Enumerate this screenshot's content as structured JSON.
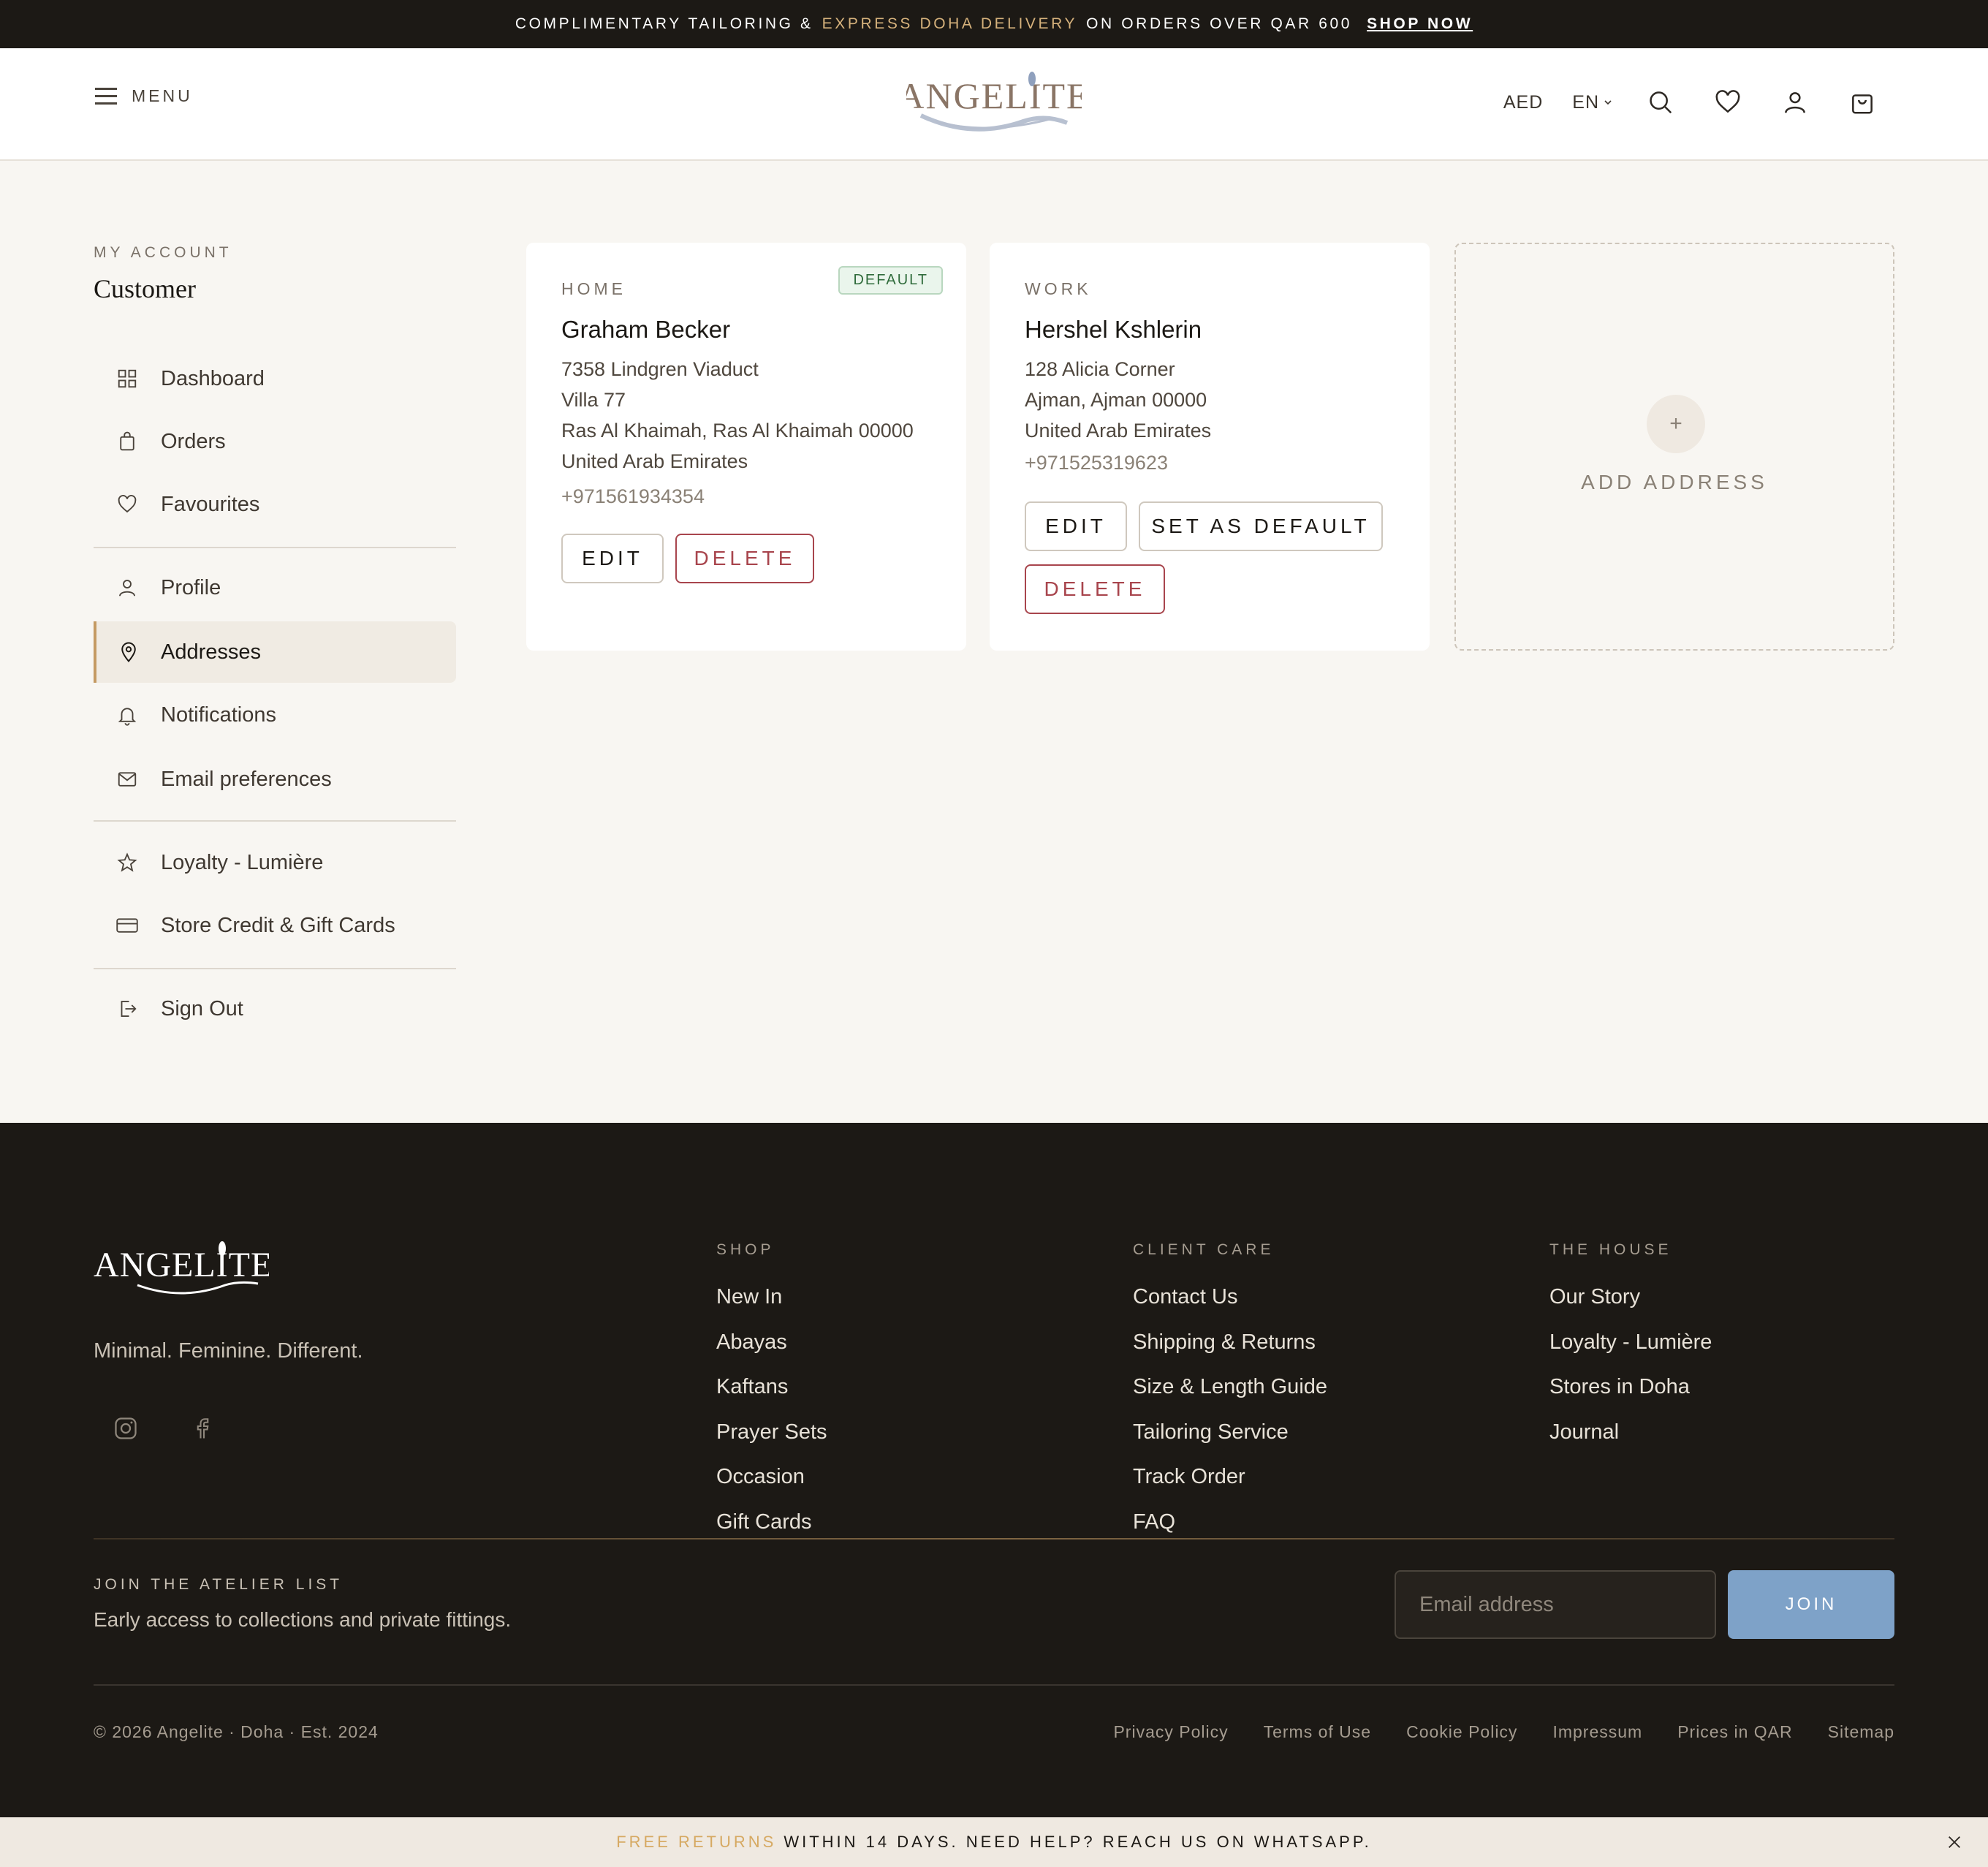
{
  "promo": {
    "text_before": "COMPLIMENTARY TAILORING &",
    "accent": "EXPRESS DOHA DELIVERY",
    "text_after": "ON ORDERS OVER QAR 600",
    "link": "SHOP NOW"
  },
  "header": {
    "menu_label": "MENU",
    "currency": "AED",
    "language": "EN",
    "icons": [
      "hamburger-icon",
      "search-icon",
      "heart-icon",
      "user-icon",
      "bag-icon"
    ]
  },
  "sidebar": {
    "section_label": "MY ACCOUNT",
    "user_name": "Customer",
    "items": [
      {
        "label": "Dashboard",
        "icon": "grid-icon"
      },
      {
        "label": "Orders",
        "icon": "bag-icon"
      },
      {
        "label": "Favourites",
        "icon": "heart-icon"
      },
      {
        "label": "Profile",
        "icon": "user-icon"
      },
      {
        "label": "Addresses",
        "icon": "location-pin-icon",
        "active": true
      },
      {
        "label": "Notifications",
        "icon": "bell-icon"
      },
      {
        "label": "Email preferences",
        "icon": "mail-icon"
      },
      {
        "label": "Loyalty - Lumière",
        "icon": "star-icon"
      },
      {
        "label": "Store Credit & Gift Cards",
        "icon": "credit-card-icon"
      },
      {
        "label": "Sign Out",
        "icon": "sign-out-icon"
      }
    ]
  },
  "addresses": [
    {
      "type": "HOME",
      "badge": "DEFAULT",
      "name": "Graham Becker",
      "line1": "7358 Lindgren Viaduct",
      "line2": "Villa 77",
      "line3": "Ras Al Khaimah, Ras Al Khaimah 00000",
      "country": "United Arab Emirates",
      "phone": "+971561934354",
      "edit_label": "EDIT",
      "delete_label": "DELETE"
    },
    {
      "type": "WORK",
      "name": "Hershel Kshlerin",
      "line1": "128 Alicia Corner",
      "line2": "Ajman, Ajman 00000",
      "country": "United Arab Emirates",
      "phone": "+971525319623",
      "edit_label": "EDIT",
      "set_default_label": "SET AS DEFAULT",
      "delete_label": "DELETE"
    }
  ],
  "add_address": {
    "plus": "+",
    "label": "ADD ADDRESS"
  },
  "footer": {
    "tagline": "Minimal. Feminine. Different.",
    "columns": [
      {
        "title": "SHOP",
        "links": [
          "New In",
          "Abayas",
          "Kaftans",
          "Prayer Sets",
          "Occasion",
          "Gift Cards"
        ]
      },
      {
        "title": "CLIENT CARE",
        "links": [
          "Contact Us",
          "Shipping & Returns",
          "Size & Length Guide",
          "Tailoring Service",
          "Track Order",
          "FAQ"
        ]
      },
      {
        "title": "THE HOUSE",
        "links": [
          "Our Story",
          "Loyalty - Lumière",
          "Stores in Doha",
          "Journal"
        ]
      }
    ],
    "newsletter": {
      "title": "JOIN THE ATELIER LIST",
      "subtitle": "Early access to collections and private fittings.",
      "placeholder": "Email address",
      "button": "JOIN"
    },
    "copyright": "© 2026 Angelite · Doha · Est. 2024",
    "legal_links": [
      "Privacy Policy",
      "Terms of Use",
      "Cookie Policy",
      "Impressum",
      "Prices in QAR",
      "Sitemap"
    ]
  },
  "bottom_bar": {
    "accent": "FREE RETURNS",
    "text": "WITHIN 14 DAYS. NEED HELP? REACH US ON WHATSAPP."
  },
  "colors": {
    "dark": "#1c1915",
    "accent_gold": "#c49a62",
    "danger": "#a8454d",
    "join_blue": "#7ea2c8",
    "background": "#f8f6f2"
  }
}
